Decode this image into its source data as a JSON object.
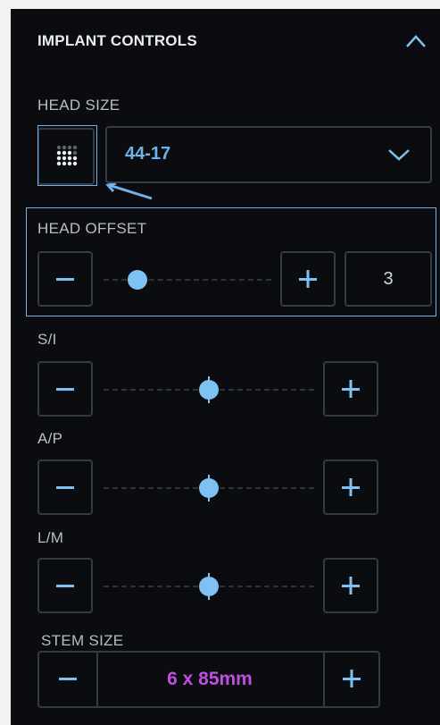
{
  "header": {
    "title": "IMPLANT CONTROLS",
    "collapse_icon": "chevron-up-icon"
  },
  "head_size": {
    "label": "HEAD SIZE",
    "grid_icon": "dot-grid-icon",
    "selected_value": "44-17",
    "dropdown_icon": "chevron-down-icon"
  },
  "head_offset": {
    "label": "HEAD OFFSET",
    "value": "3",
    "level": 0.2
  },
  "si": {
    "label": "S/I",
    "level": 0.5
  },
  "ap": {
    "label": "A/P",
    "level": 0.5
  },
  "lm": {
    "label": "L/M",
    "level": 0.5
  },
  "stem_size": {
    "label": "STEM SIZE",
    "value": "6 x 85mm"
  },
  "colors": {
    "accent": "#6fb3ea",
    "thumb": "#7ec2f3",
    "stem_value": "#c04fe0",
    "panel_bg": "#0b0c0f",
    "border": "#353a45"
  }
}
